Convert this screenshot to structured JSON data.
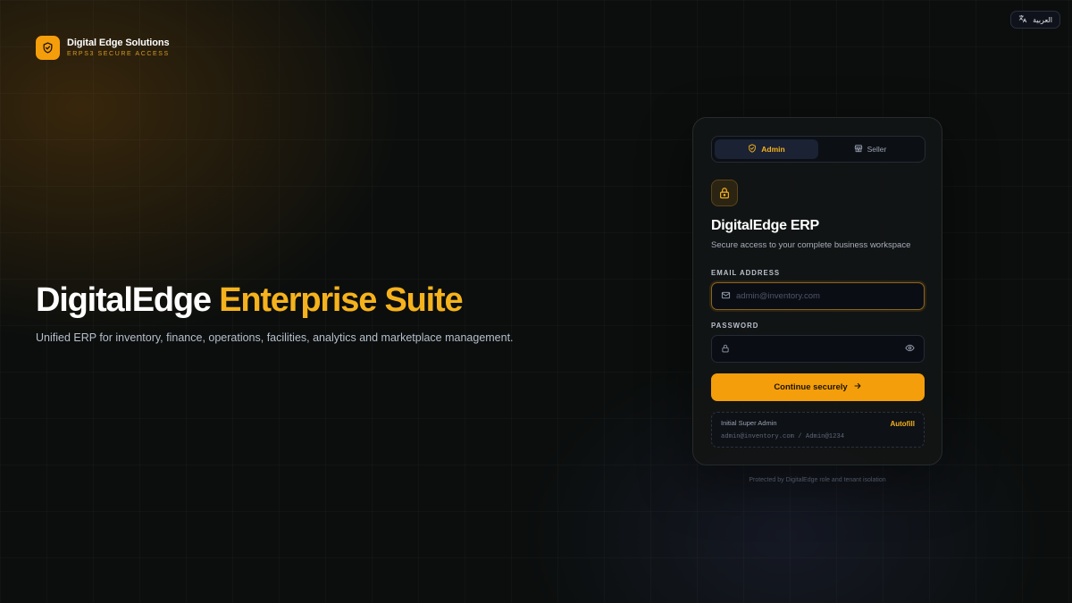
{
  "brand": {
    "name": "Digital Edge Solutions",
    "subtitle": "ERPS3 SECURE ACCESS"
  },
  "language_toggle": {
    "label": "العربية"
  },
  "hero": {
    "title_part1": "DigitalEdge",
    "title_part2": "Enterprise Suite",
    "description": "Unified ERP for inventory, finance, operations, facilities, analytics and marketplace management."
  },
  "login_card": {
    "tabs": [
      {
        "label": "Admin",
        "icon": "shield-icon",
        "active": true
      },
      {
        "label": "Seller",
        "icon": "store-icon",
        "active": false
      }
    ],
    "title": "DigitalEdge ERP",
    "subtitle": "Secure access to your complete business workspace",
    "email": {
      "label": "EMAIL ADDRESS",
      "placeholder": "admin@inventory.com",
      "value": ""
    },
    "password": {
      "label": "PASSWORD",
      "placeholder": "",
      "value": ""
    },
    "submit_label": "Continue securely",
    "hint": {
      "title": "Initial Super Admin",
      "action_label": "Autofill",
      "credentials": "admin@inventory.com / Admin@1234"
    }
  },
  "footer_note": "Protected by DigitalEdge role and tenant isolation",
  "colors": {
    "accent": "#f59e0b",
    "accent_text": "#f6b21c",
    "background": "#0b0e0d",
    "card_background": "#121515"
  }
}
